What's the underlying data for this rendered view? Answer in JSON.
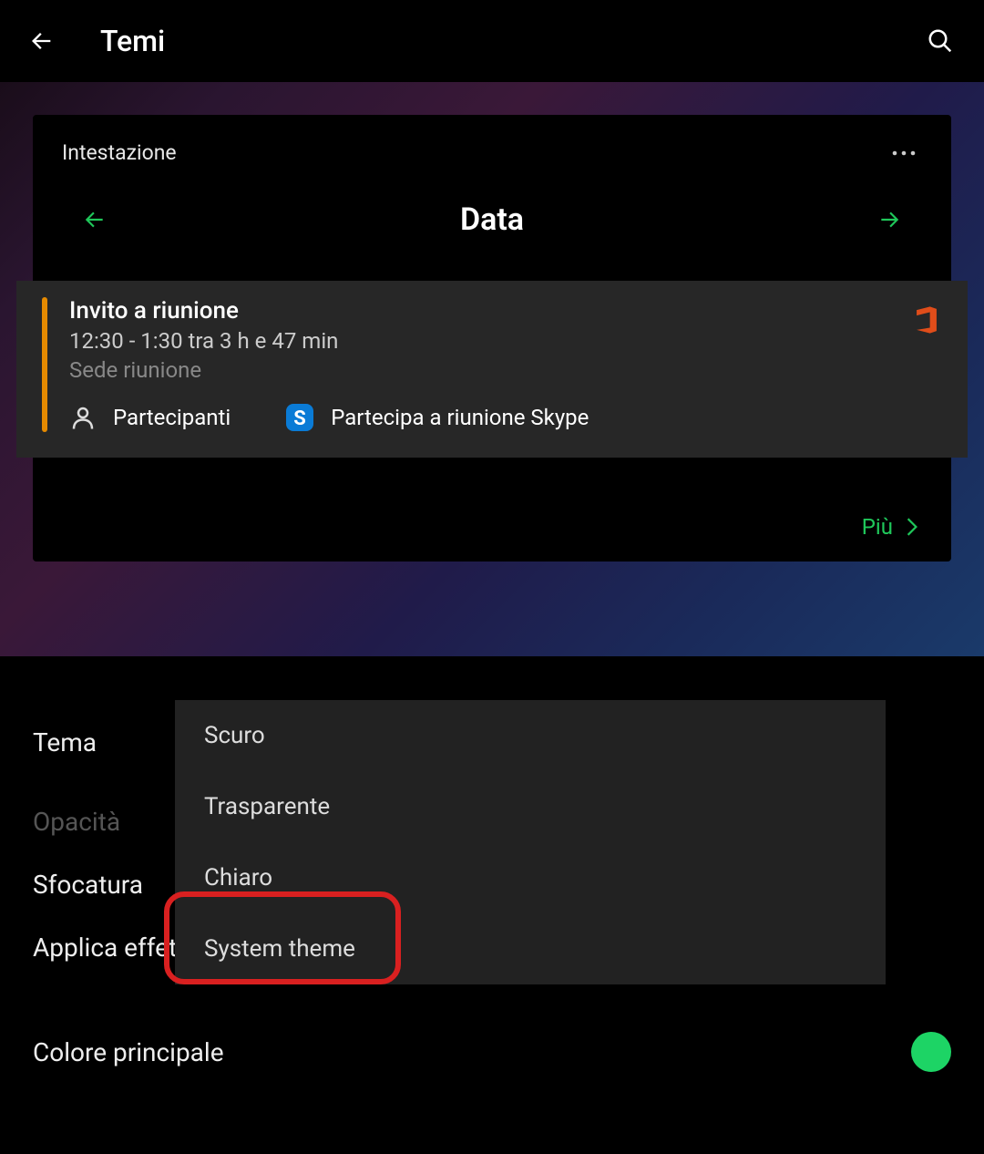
{
  "topbar": {
    "title": "Temi"
  },
  "preview": {
    "header_label": "Intestazione",
    "date_label": "Data",
    "meeting": {
      "title": "Invito a riunione",
      "time": "12:30 - 1:30  tra 3 h e 47 min",
      "location": "Sede riunione",
      "participants_label": "Partecipanti",
      "skype_label": "Partecipa a riunione Skype"
    },
    "more_label": "Più"
  },
  "settings": {
    "theme_label": "Tema",
    "opacity_label": "Opacità",
    "blur_label": "Sfocatura",
    "effects_label": "Applica effetti",
    "primary_color_label": "Colore principale",
    "primary_color_value": "#1dd465"
  },
  "dropdown": {
    "options": [
      "Scuro",
      "Trasparente",
      "Chiaro",
      "System theme"
    ]
  }
}
